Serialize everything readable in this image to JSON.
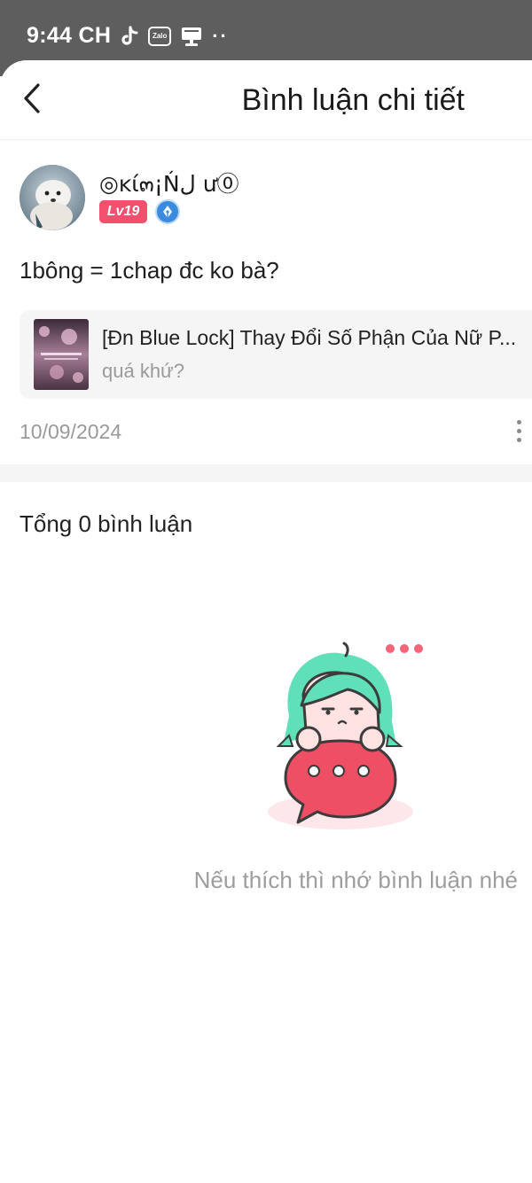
{
  "status_bar": {
    "time": "9:44 CH",
    "icons": [
      "tiktok-icon",
      "zalo-icon",
      "notification-icon",
      "more-dots-icon"
    ],
    "zalo_text": "Zalo",
    "dots": "··"
  },
  "header": {
    "back_icon": "chevron-left-icon",
    "title": "Bình luận chi tiết"
  },
  "post": {
    "author": {
      "name": "◎ĸί๓¡Ńل ư⓪",
      "level": "Lv19",
      "badge_icon": "pen-nib-badge-icon"
    },
    "text": "1bông = 1chap đc ko bà?",
    "story": {
      "title": "[Đn Blue Lock] Thay Đổi Số Phận Của Nữ P...",
      "subtitle": "quá khứ?"
    },
    "date": "10/09/2024",
    "more_icon": "more-vertical-icon"
  },
  "comments": {
    "total_label": "Tổng 0 bình luận",
    "empty_message": "Nếu thích thì nhớ bình luận nhé",
    "empty_illustration": "mascot-chat-bubble-illustration"
  },
  "colors": {
    "status_bar_bg": "#5e5e5e",
    "level_badge": "#f2506c",
    "badge_blue": "#3a8be0",
    "muted_text": "#9a9a9a",
    "mascot_hair": "#5fe0b8",
    "bubble_red": "#ef4f64"
  }
}
